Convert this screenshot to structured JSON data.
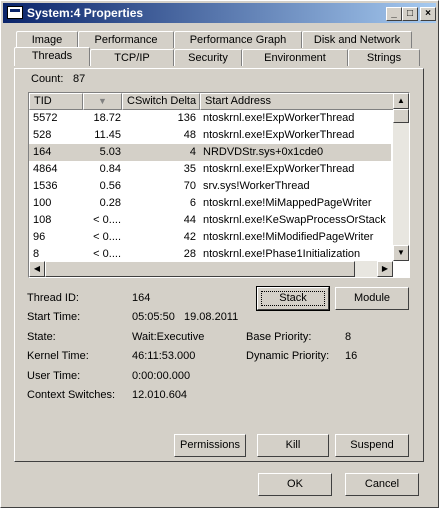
{
  "window": {
    "title": "System:4 Properties",
    "controls": {
      "minimize": "_",
      "maximize": "□",
      "close": "×"
    }
  },
  "tabs_row1": [
    "Image",
    "Performance",
    "Performance Graph",
    "Disk and Network"
  ],
  "tabs_row2": [
    "Threads",
    "TCP/IP",
    "Security",
    "Environment",
    "Strings"
  ],
  "active_tab": "Threads",
  "count": {
    "label": "Count:",
    "value": "87"
  },
  "thread_list": {
    "columns": [
      "TID",
      "",
      "CSwitch Delta",
      "Start Address"
    ],
    "sort_indicator": "▼",
    "rows": [
      {
        "tid": "5572",
        "cpu": "18.72",
        "cswitch": "136",
        "start": "ntoskrnl.exe!ExpWorkerThread",
        "selected": false
      },
      {
        "tid": "528",
        "cpu": "11.45",
        "cswitch": "48",
        "start": "ntoskrnl.exe!ExpWorkerThread",
        "selected": false
      },
      {
        "tid": "164",
        "cpu": "5.03",
        "cswitch": "4",
        "start": "NRDVDStr.sys+0x1cde0",
        "selected": true
      },
      {
        "tid": "4864",
        "cpu": "0.84",
        "cswitch": "35",
        "start": "ntoskrnl.exe!ExpWorkerThread",
        "selected": false
      },
      {
        "tid": "1536",
        "cpu": "0.56",
        "cswitch": "70",
        "start": "srv.sys!WorkerThread",
        "selected": false
      },
      {
        "tid": "100",
        "cpu": "0.28",
        "cswitch": "6",
        "start": "ntoskrnl.exe!MiMappedPageWriter",
        "selected": false
      },
      {
        "tid": "108",
        "cpu": "< 0....",
        "cswitch": "44",
        "start": "ntoskrnl.exe!KeSwapProcessOrStack",
        "selected": false
      },
      {
        "tid": "96",
        "cpu": "< 0....",
        "cswitch": "42",
        "start": "ntoskrnl.exe!MiModifiedPageWriter",
        "selected": false
      },
      {
        "tid": "8",
        "cpu": "< 0....",
        "cswitch": "28",
        "start": "ntoskrnl.exe!Phase1Initialization",
        "selected": false
      }
    ]
  },
  "details": {
    "thread_id": {
      "label": "Thread ID:",
      "value": "164"
    },
    "start_time": {
      "label": "Start Time:",
      "value": "05:05:50   19.08.2011"
    },
    "state": {
      "label": "State:",
      "value": "Wait:Executive"
    },
    "kernel_time": {
      "label": "Kernel Time:",
      "value": "46:11:53.000"
    },
    "user_time": {
      "label": "User Time:",
      "value": "0:00:00.000"
    },
    "context_switches": {
      "label": "Context Switches:",
      "value": "12.010.604"
    },
    "base_priority": {
      "label": "Base Priority:",
      "value": "8"
    },
    "dynamic_priority": {
      "label": "Dynamic Priority:",
      "value": "16"
    }
  },
  "buttons": {
    "stack": "Stack",
    "module": "Module",
    "permissions": "Permissions",
    "kill": "Kill",
    "suspend": "Suspend",
    "ok": "OK",
    "cancel": "Cancel"
  }
}
